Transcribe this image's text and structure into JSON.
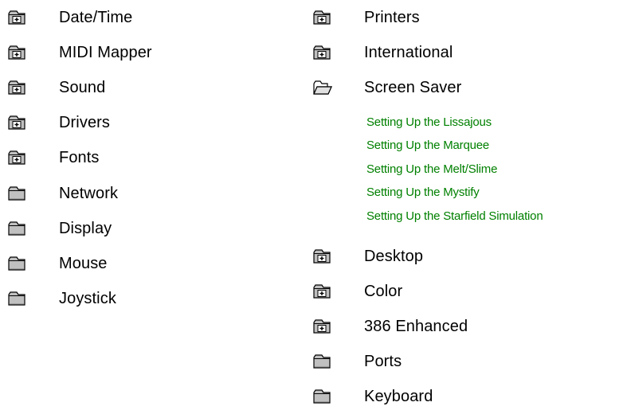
{
  "colors": {
    "topic_text": "#000000",
    "subtopic_text": "#008000",
    "folder_fill": "#c0c0c0",
    "folder_outline": "#000000",
    "background": "#ffffff"
  },
  "left_column": [
    {
      "label": "Date/Time",
      "icon": "closed-book-plus-icon"
    },
    {
      "label": "MIDI Mapper",
      "icon": "closed-book-plus-icon"
    },
    {
      "label": "Sound",
      "icon": "closed-book-plus-icon"
    },
    {
      "label": "Drivers",
      "icon": "closed-book-plus-icon"
    },
    {
      "label": "Fonts",
      "icon": "closed-book-plus-icon"
    },
    {
      "label": "Network",
      "icon": "folder-icon"
    },
    {
      "label": "Display",
      "icon": "folder-icon"
    },
    {
      "label": "Mouse",
      "icon": "folder-icon"
    },
    {
      "label": "Joystick",
      "icon": "folder-icon"
    }
  ],
  "right_column": {
    "top": [
      {
        "label": "Printers",
        "icon": "closed-book-plus-icon"
      },
      {
        "label": "International",
        "icon": "closed-book-plus-icon"
      },
      {
        "label": "Screen Saver",
        "icon": "open-folder-icon"
      }
    ],
    "screen_saver_subtopics": [
      "Setting Up the Lissajous",
      "Setting Up the Marquee",
      "Setting Up the Melt/Slime",
      "Setting Up the Mystify",
      "Setting Up the Starfield Simulation"
    ],
    "bottom": [
      {
        "label": "Desktop",
        "icon": "closed-book-plus-icon"
      },
      {
        "label": "Color",
        "icon": "closed-book-plus-icon"
      },
      {
        "label": "386 Enhanced",
        "icon": "closed-book-plus-icon"
      },
      {
        "label": "Ports",
        "icon": "folder-icon"
      },
      {
        "label": "Keyboard",
        "icon": "folder-icon"
      }
    ]
  }
}
